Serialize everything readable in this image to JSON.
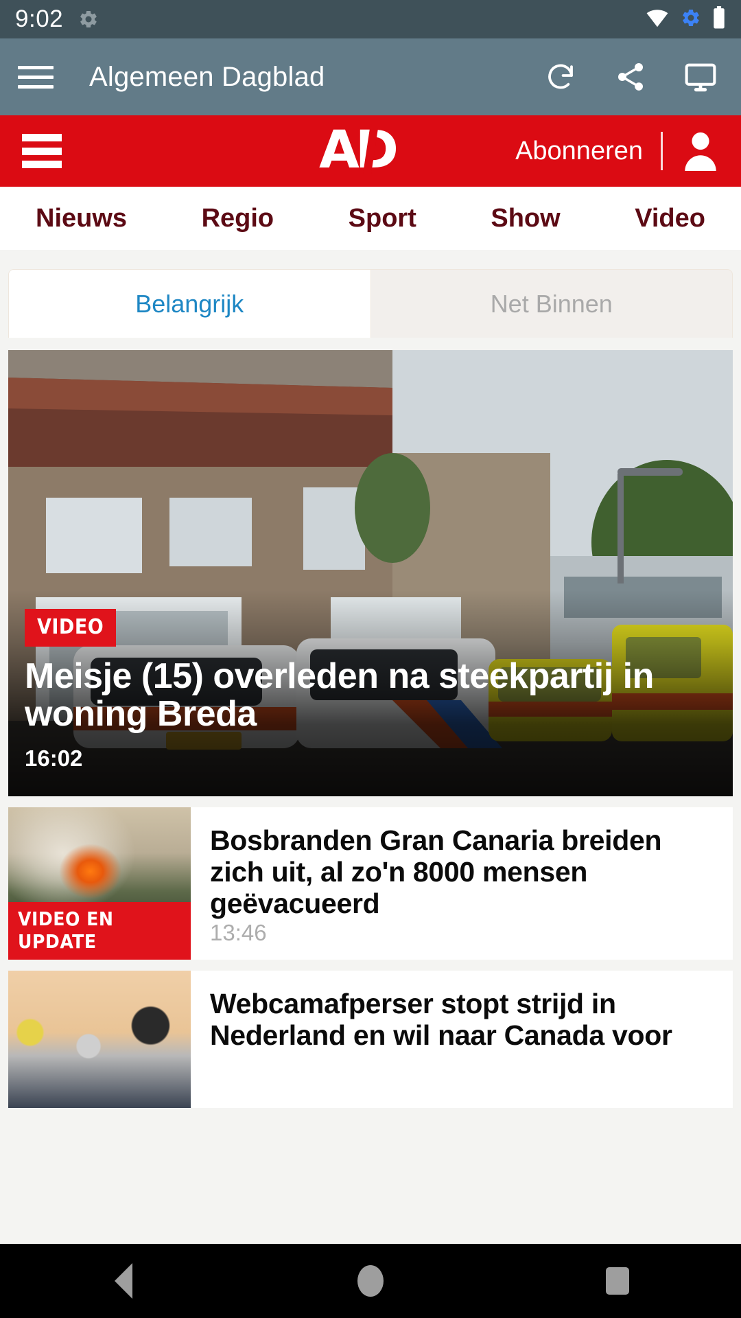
{
  "statusbar": {
    "clock": "9:02",
    "icons": [
      "settings-gear-icon",
      "wifi-icon",
      "sync-gear-icon",
      "battery-icon"
    ]
  },
  "appbar": {
    "menu_icon": "hamburger-menu-icon",
    "title": "Algemeen Dagblad",
    "actions": [
      {
        "name": "refresh-icon",
        "label": "Refresh"
      },
      {
        "name": "share-icon",
        "label": "Share"
      },
      {
        "name": "cast-screen-icon",
        "label": "Cast"
      }
    ]
  },
  "site_header": {
    "menu_icon": "hamburger-menu-icon",
    "logo_text": "AD",
    "subscribe_label": "Abonneren",
    "account_icon": "user-account-icon",
    "background_color": "#db0b13"
  },
  "nav": {
    "items": [
      {
        "label": "Nieuws"
      },
      {
        "label": "Regio"
      },
      {
        "label": "Sport"
      },
      {
        "label": "Show"
      },
      {
        "label": "Video"
      }
    ],
    "text_color": "#5c0a14"
  },
  "tabs": {
    "active_color": "#1e87c4",
    "inactive_color": "#a9a9a9",
    "items": [
      {
        "label": "Belangrijk",
        "active": true
      },
      {
        "label": "Net Binnen",
        "active": false
      }
    ]
  },
  "feed": {
    "hero": {
      "badge": "VIDEO",
      "headline": "Meisje (15) overleden na steekpartij in woning Breda",
      "time": "16:02",
      "image_alt": "politie-auto-straat-foto"
    },
    "articles": [
      {
        "badge": "VIDEO EN UPDATE",
        "headline": "Bosbranden Gran Canaria breiden zich uit, al zo'n 8000 mensen geëvacueerd",
        "time": "13:46",
        "image_alt": "bosbrand-rook-foto"
      },
      {
        "badge": "",
        "headline": "Webcamafperser stopt strijd in Nederland en wil naar Canada voor",
        "time": "",
        "image_alt": "rechtbank-illustratie"
      }
    ]
  },
  "system_nav": {
    "back": "back-button",
    "home": "home-button",
    "recents": "recents-button"
  }
}
